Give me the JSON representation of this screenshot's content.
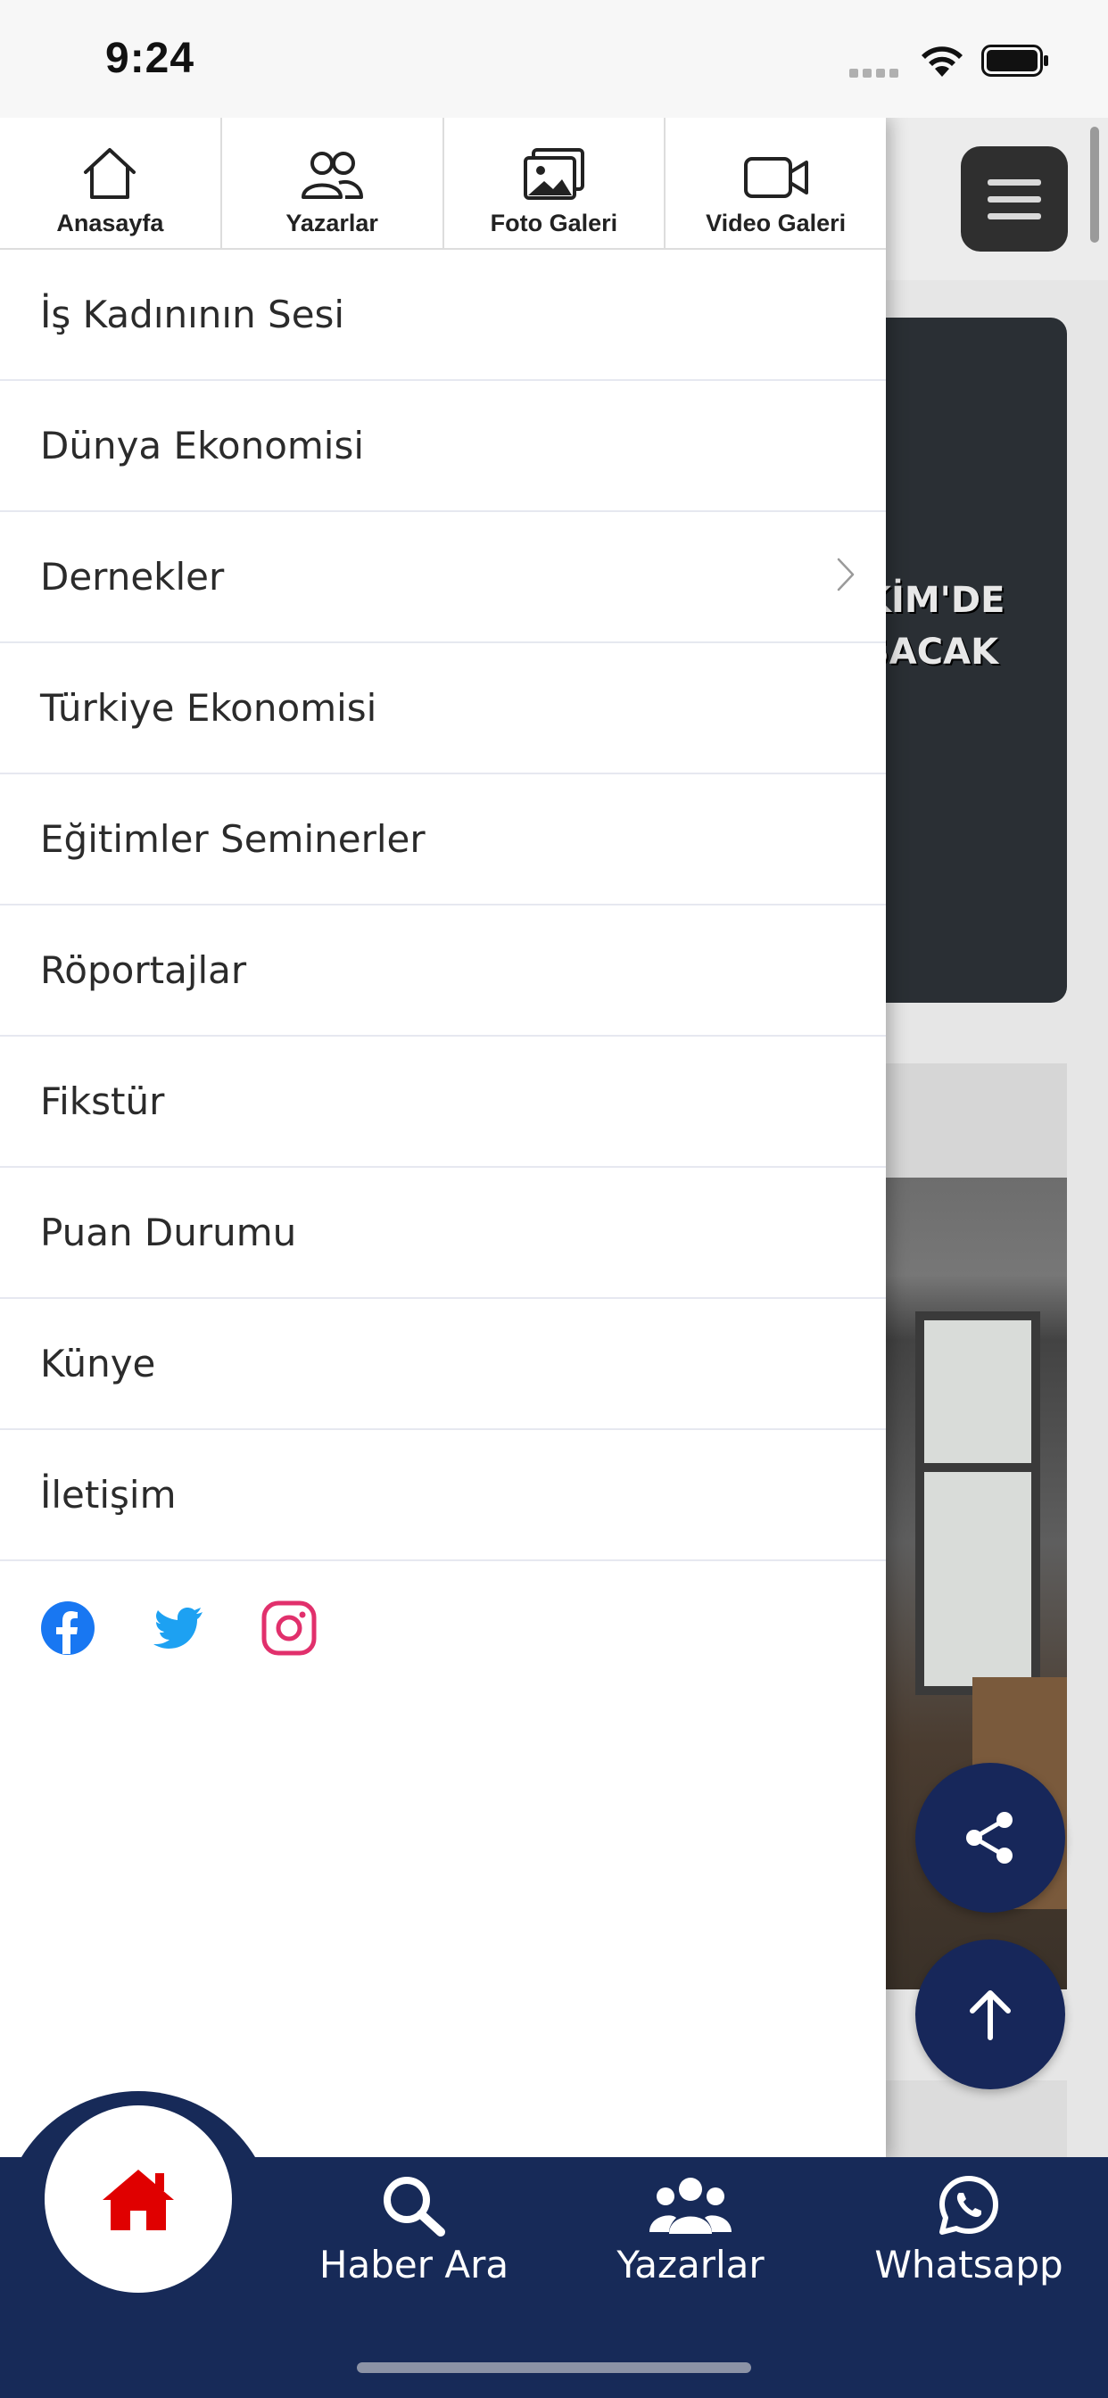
{
  "status_bar": {
    "time": "9:24"
  },
  "quick_nav": [
    {
      "label": "Anasayfa",
      "icon": "home-outline-icon"
    },
    {
      "label": "Yazarlar",
      "icon": "users-outline-icon"
    },
    {
      "label": "Foto Galeri",
      "icon": "image-gallery-icon"
    },
    {
      "label": "Video Galeri",
      "icon": "video-camera-icon"
    }
  ],
  "menu": [
    {
      "label": "İş Kadınının Sesi"
    },
    {
      "label": "Dünya Ekonomisi"
    },
    {
      "label": "Dernekler",
      "has_submenu": true
    },
    {
      "label": "Türkiye Ekonomisi"
    },
    {
      "label": "Eğitimler Seminerler"
    },
    {
      "label": "Röportajlar"
    },
    {
      "label": "Fikstür"
    },
    {
      "label": "Puan Durumu"
    },
    {
      "label": "Künye"
    },
    {
      "label": "İletişim"
    }
  ],
  "social": [
    {
      "name": "facebook",
      "icon": "facebook-icon",
      "color": "#1877f2"
    },
    {
      "name": "twitter",
      "icon": "twitter-icon",
      "color": "#1da1f2"
    },
    {
      "name": "instagram",
      "icon": "instagram-icon",
      "color": "#e1306c"
    }
  ],
  "background": {
    "headline_lines": [
      "KİM'DE",
      "ŞACAK"
    ]
  },
  "tabbar": {
    "home_icon_color": "#e00000",
    "tabs": [
      {
        "label": "Haber Ara",
        "icon": "search-icon"
      },
      {
        "label": "Yazarlar",
        "icon": "users-icon"
      },
      {
        "label": "Whatsapp",
        "icon": "whatsapp-icon"
      }
    ]
  },
  "colors": {
    "navy": "#172a58",
    "fab": "#17275a"
  }
}
